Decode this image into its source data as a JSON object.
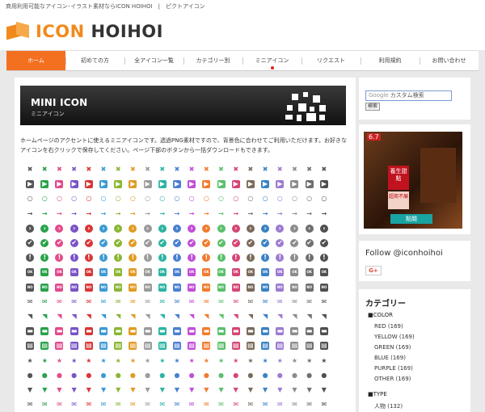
{
  "topbar": {
    "tagline": "商用利用可能なアイコン･イラスト素材ならICON HOIHOI　|　ピクトアイコン"
  },
  "logo": {
    "part1": "ICON",
    "part2": "HOIHOI"
  },
  "nav": [
    "ホーム",
    "初めての方",
    "全アイコン一覧",
    "カテゴリー別",
    "ミニアイコン",
    "リクエスト",
    "利用規約",
    "お問い合わせ"
  ],
  "banner": {
    "title": "MINI ICON",
    "subtitle": "ミニアイコン"
  },
  "intro": "ホームページのアクセントに使えるミニアイコンです。透過PNG素材ですので、背景色に合わせてご利用いただけます。お好きなアイコンを右クリックで保存してください。ページ下部のボタンから一括ダウンロードもできます。",
  "icon_rows": [
    {
      "glyph": "✖",
      "name": "close"
    },
    {
      "glyph": "▶",
      "name": "play"
    },
    {
      "glyph": "○",
      "name": "ring"
    },
    {
      "glyph": "→",
      "name": "arrow"
    },
    {
      "glyph": "›",
      "name": "next"
    },
    {
      "glyph": "✔",
      "name": "check"
    },
    {
      "glyph": "!",
      "name": "alert"
    },
    {
      "glyph": "OK",
      "name": "ok"
    },
    {
      "glyph": "NO",
      "name": "no"
    },
    {
      "glyph": "✉",
      "name": "mail"
    },
    {
      "glyph": "◥",
      "name": "rss"
    },
    {
      "glyph": "▬",
      "name": "bar"
    },
    {
      "glyph": "▤",
      "name": "document"
    },
    {
      "glyph": "★",
      "name": "star"
    },
    {
      "glyph": "●",
      "name": "speech"
    },
    {
      "glyph": "▼",
      "name": "down"
    },
    {
      "glyph": "✉",
      "name": "envelope"
    }
  ],
  "icon_colors": [
    "#555555",
    "#2aa24a",
    "#e24b8b",
    "#7a53c6",
    "#d93636",
    "#3c9ad3",
    "#8ab634",
    "#e09b22",
    "#9b9b9b",
    "#2bb4a0",
    "#4a7fd1",
    "#c14fd6",
    "#f07c2e",
    "#5bbf6b",
    "#d64574",
    "#7a6a5a",
    "#3b82c4",
    "#9c7bd1",
    "#8c8c8c",
    "#6f6f6f",
    "#4f4f4f"
  ],
  "search": {
    "google_label": "Google",
    "placeholder": "カスタム検索",
    "button": "検索"
  },
  "ad": {
    "badge": "6.7",
    "red_text": "養生甜點",
    "pink_text": "超商不展",
    "button": "點閱"
  },
  "follow": {
    "text": "Follow @iconhoihoi",
    "gplus": "G+"
  },
  "categories": {
    "title": "カテゴリー",
    "group1": "■COLOR",
    "colors": [
      "RED (169)",
      "YELLOW (169)",
      "GREEN (169)",
      "BLUE (169)",
      "PURPLE (169)",
      "OTHER (169)"
    ],
    "group2": "■TYPE",
    "types": [
      "人物 (132)"
    ]
  }
}
